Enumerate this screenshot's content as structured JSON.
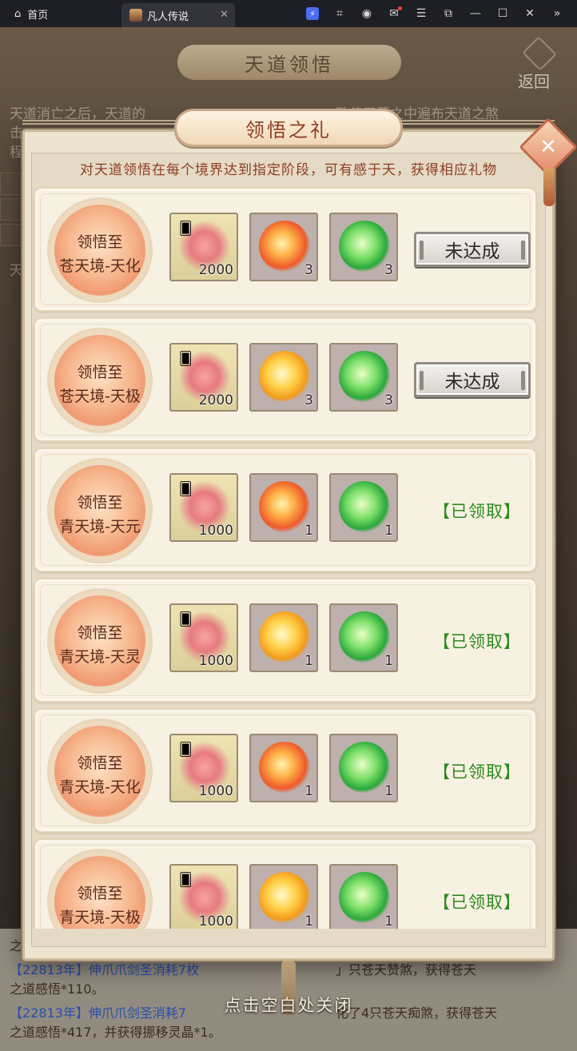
{
  "browser": {
    "home_label": "首页",
    "tab_title": "凡人传说",
    "tab_close": "✕",
    "icons": [
      "bolt-icon",
      "gamepad-icon",
      "user-icon",
      "mail-icon",
      "menu-icon",
      "external-icon",
      "minimize-icon",
      "maximize-icon",
      "close-icon",
      "expand-icon"
    ]
  },
  "background": {
    "title": "天道领悟",
    "back_label": "返回",
    "lines": [
      "天道消亡之后，天道的",
      "击",
      "程"
    ],
    "lines_right": "致使天墓之中遍布天道之煞",
    "side_letter": "天",
    "log": [
      {
        "pre": "之",
        "text": ""
      },
      {
        "text": "【22813年】伸爪爪剑圣消耗7枚",
        "mid": "」只苍天赞煞，获得苍天"
      },
      {
        "text": "之道感悟*110。"
      },
      {
        "text": "【22813年】伸爪爪剑圣消耗7",
        "mid": "化了4只苍天痴煞，获得苍天"
      },
      {
        "text": "之道感悟*417，并获得挪移灵晶*1。"
      }
    ]
  },
  "modal": {
    "title": "领悟之礼",
    "subtitle": "对天道领悟在每个境界达到指定阶段，可有感于天，获得相应礼物",
    "close_symbol": "✕",
    "rows": [
      {
        "line1": "领悟至",
        "line2": "苍天境-天化",
        "items": [
          {
            "type": "scroll",
            "qty": "2000"
          },
          {
            "type": "fire",
            "qty": "3"
          },
          {
            "type": "green",
            "qty": "3"
          }
        ],
        "status": "未达成",
        "claimed": false
      },
      {
        "line1": "领悟至",
        "line2": "苍天境-天极",
        "items": [
          {
            "type": "scroll",
            "qty": "2000"
          },
          {
            "type": "gold",
            "qty": "3"
          },
          {
            "type": "green",
            "qty": "3"
          }
        ],
        "status": "未达成",
        "claimed": false
      },
      {
        "line1": "领悟至",
        "line2": "青天境-天元",
        "items": [
          {
            "type": "scroll",
            "qty": "1000"
          },
          {
            "type": "fire",
            "qty": "1"
          },
          {
            "type": "green",
            "qty": "1"
          }
        ],
        "status": "【已领取】",
        "claimed": true
      },
      {
        "line1": "领悟至",
        "line2": "青天境-天灵",
        "items": [
          {
            "type": "scroll",
            "qty": "1000"
          },
          {
            "type": "gold",
            "qty": "1"
          },
          {
            "type": "green",
            "qty": "1"
          }
        ],
        "status": "【已领取】",
        "claimed": true
      },
      {
        "line1": "领悟至",
        "line2": "青天境-天化",
        "items": [
          {
            "type": "scroll",
            "qty": "1000"
          },
          {
            "type": "fire",
            "qty": "1"
          },
          {
            "type": "green",
            "qty": "1"
          }
        ],
        "status": "【已领取】",
        "claimed": true
      },
      {
        "line1": "领悟至",
        "line2": "青天境-天极",
        "items": [
          {
            "type": "scroll",
            "qty": "1000"
          },
          {
            "type": "gold",
            "qty": "1"
          },
          {
            "type": "green",
            "qty": "1"
          }
        ],
        "status": "【已领取】",
        "claimed": true
      }
    ]
  },
  "close_hint": "点击空白处关闭",
  "colors": {
    "title_text": "#8e3d25",
    "claimed": "#2e8a1e",
    "panel": "#f7f1e2"
  }
}
